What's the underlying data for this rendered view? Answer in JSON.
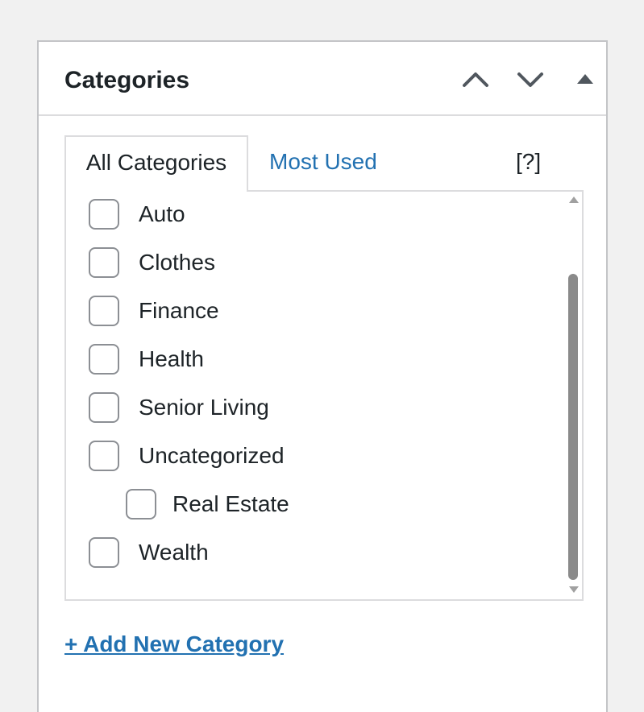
{
  "panel": {
    "title": "Categories",
    "move_up_icon": "chevron-up-icon",
    "move_down_icon": "chevron-down-icon",
    "toggle_icon": "triangle-up-icon"
  },
  "tabs": {
    "all_label": "All Categories",
    "most_used_label": "Most Used",
    "help_label": "[?]"
  },
  "categories": [
    {
      "label": "Auto",
      "checked": false,
      "level": 0
    },
    {
      "label": "Clothes",
      "checked": false,
      "level": 0
    },
    {
      "label": "Finance",
      "checked": false,
      "level": 0
    },
    {
      "label": "Health",
      "checked": false,
      "level": 0
    },
    {
      "label": "Senior Living",
      "checked": false,
      "level": 0
    },
    {
      "label": "Uncategorized",
      "checked": false,
      "level": 0
    },
    {
      "label": "Real Estate",
      "checked": false,
      "level": 1
    },
    {
      "label": "Wealth",
      "checked": false,
      "level": 0
    }
  ],
  "add_new_label": "+ Add New Category",
  "colors": {
    "link": "#2271b1",
    "text": "#1d2327",
    "border": "#dcdcde",
    "background": "#f1f1f1"
  }
}
